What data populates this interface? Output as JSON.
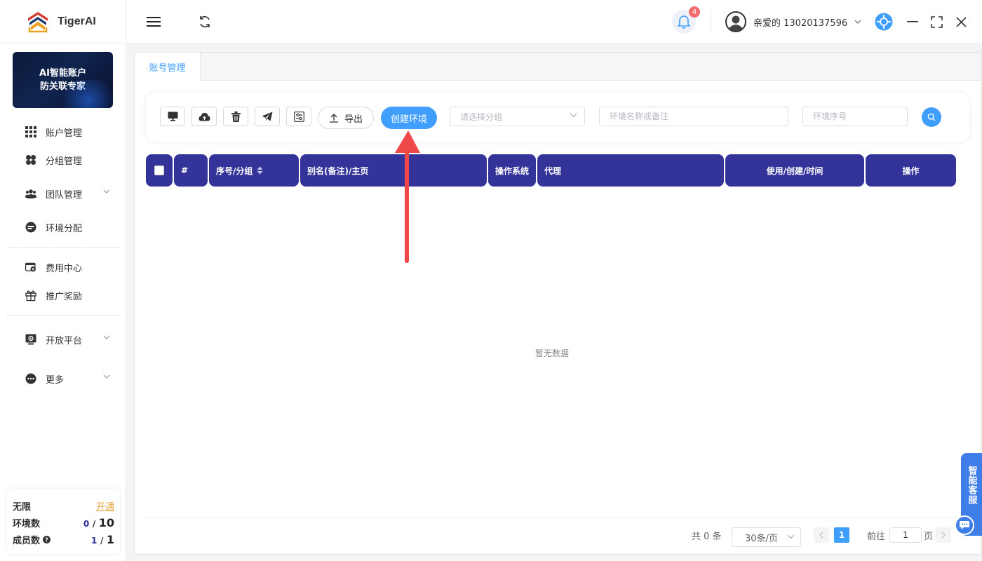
{
  "app": {
    "name": "TigerAI"
  },
  "banner": {
    "line1": "AI智能账户",
    "line2": "防关联专家"
  },
  "sidebar": {
    "items": [
      {
        "label": "账户管理",
        "icon": "grid-icon"
      },
      {
        "label": "分组管理",
        "icon": "clover-icon"
      },
      {
        "label": "团队管理",
        "icon": "team-icon",
        "has_children": true
      },
      {
        "label": "环境分配",
        "icon": "distribute-icon"
      },
      {
        "label": "费用中心",
        "icon": "billing-icon"
      },
      {
        "label": "推广奖励",
        "icon": "gift-icon"
      },
      {
        "label": "开放平台",
        "icon": "api-icon",
        "has_children": true
      },
      {
        "label": "更多",
        "icon": "more-icon",
        "has_children": true
      }
    ]
  },
  "quota": {
    "plan": "无限",
    "open_link": "开通",
    "env_label": "环境数",
    "env_used": "0",
    "env_total": "10",
    "member_label": "成员数",
    "member_used": "1",
    "member_total": "1",
    "separator": "/"
  },
  "header": {
    "notification_count": "4",
    "user_name": "亲爱的 13020137596"
  },
  "tabs": [
    {
      "label": "账号管理",
      "active": true
    }
  ],
  "toolbar": {
    "export_label": "导出",
    "create_label": "创建环境",
    "group_placeholder": "请选择分组",
    "name_placeholder": "环境名称或备注",
    "seq_placeholder": "环境序号"
  },
  "table": {
    "columns": [
      "#",
      "序号/分组",
      "别名(备注)/主页",
      "操作系统",
      "代理",
      "使用/创建/时间",
      "操作"
    ],
    "empty_text": "暂无数据"
  },
  "pagination": {
    "total_text": "共 0 条",
    "page_size": "30条/页",
    "current_page": "1",
    "goto_label": "前往",
    "goto_value": "1",
    "page_suffix": "页"
  },
  "customer_service": {
    "label": "智能客服"
  },
  "colors": {
    "primary": "#409eff",
    "header_bg": "#333399",
    "annotation_arrow": "#f04848"
  }
}
